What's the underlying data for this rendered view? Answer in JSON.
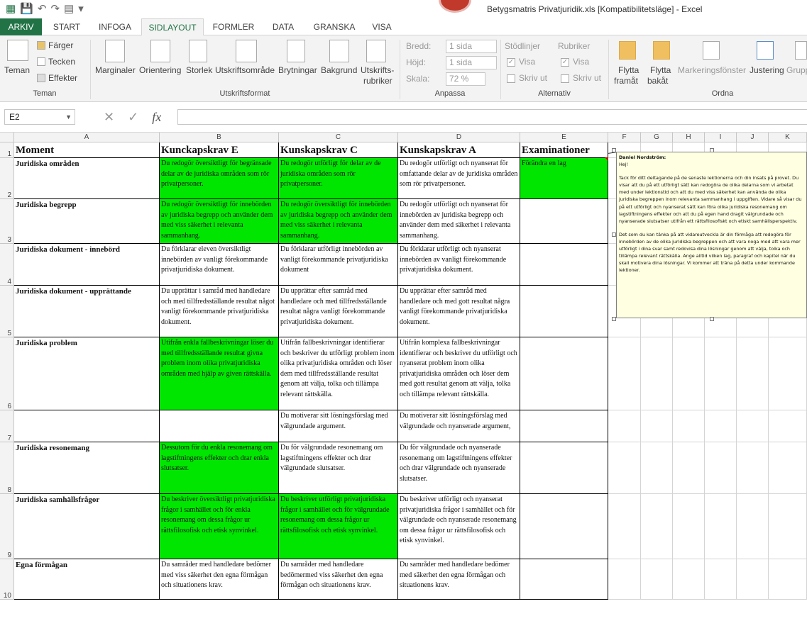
{
  "window": {
    "title": "Betygsmatris Privatjuridik.xls  [Kompatibilitetsläge] - Excel"
  },
  "ribbon_tabs": [
    "ARKIV",
    "START",
    "INFOGA",
    "SIDLAYOUT",
    "FORMLER",
    "DATA",
    "GRANSKA",
    "VISA"
  ],
  "ribbon": {
    "teman": {
      "themes": "Teman",
      "colors": "Färger",
      "fonts": "Tecken",
      "effects": "Effekter",
      "group": "Teman"
    },
    "page_setup": {
      "margins": "Marginaler",
      "orientation": "Orientering",
      "size": "Storlek",
      "print_area": "Utskriftsområde",
      "breaks": "Brytningar",
      "background": "Bakgrund",
      "print_titles_1": "Utskrifts-",
      "print_titles_2": "rubriker",
      "group": "Utskriftsformat"
    },
    "scale": {
      "width_label": "Bredd:",
      "width_value": "1 sida",
      "height_label": "Höjd:",
      "height_value": "1 sida",
      "scale_label": "Skala:",
      "scale_value": "72 %",
      "group": "Anpassa"
    },
    "sheet_options": {
      "gridlines": "Stödlinjer",
      "headings": "Rubriker",
      "view": "Visa",
      "print": "Skriv ut",
      "group": "Alternativ"
    },
    "arrange": {
      "forward_1": "Flytta",
      "forward_2": "framåt",
      "backward_1": "Flytta",
      "backward_2": "bakåt",
      "selection_pane": "Markeringsfönster",
      "align": "Justering",
      "group_btn": "Grupp",
      "group": "Ordna"
    }
  },
  "formula_bar": {
    "name_box": "E2",
    "fx": "fx"
  },
  "columns": [
    "A",
    "B",
    "C",
    "D",
    "E",
    "F",
    "G",
    "H",
    "I",
    "J",
    "K"
  ],
  "rows": [
    "1",
    "2",
    "3",
    "4",
    "5",
    "6",
    "7",
    "8",
    "9",
    "10"
  ],
  "sheet": {
    "headers": [
      "Moment",
      "Kunckapskrav E",
      "Kunskapskrav C",
      "Kunskapskrav A",
      "Examinationer"
    ],
    "row_labels": [
      "Juridiska områden",
      "Juridiska begrepp",
      "Juridiska dokument - innebörd",
      "Juridiska dokument - upprättande",
      "Juridiska problem",
      "",
      "Juridiska resonemang",
      "Juridiska samhällsfrågor",
      "Egna förmågan"
    ],
    "b": [
      "Du redogör översiktligt för begränsade delar av de juridiska områden som rör privatpersoner.",
      "Du redogör översiktligt för innebörden av juridiska begrepp och använder dem med viss säkerhet i relevanta sammanhang.",
      "Du förklarar eleven översiktligt innebörden av vanligt förekommande privatjuridiska dokument.",
      "Du upprättar i samråd med handledare och med tillfredsställande resultat något vanligt förekommande privatjuridiska dokument.",
      "Utifrån enkla fallbeskrivningar löser du med tillfredsställande resultat givna problem inom olika privatjuridiska områden med hjälp av given rättskälla.",
      "",
      "Dessutom för du enkla resonemang om lagstiftningens effekter och drar enkla slutsatser.",
      "Du beskriver översiktligt privatjuridiska frågor i samhället och för enkla resonemang om dessa frågor ur rättsfilosofisk och etisk synvinkel.",
      "Du samråder med handledare bedömer med viss säkerhet den egna förmågan och situationens krav."
    ],
    "c": [
      "Du redogör utförligt för delar av de juridiska områden som rör privatpersoner.",
      "Du redogör översiktligt för innebörden av juridiska begrepp och använder dem med viss säkerhet i relevanta sammanhang.",
      "Du förklarar utförligt innebörden av vanligt förekommande privatjuridiska dokument",
      "Du upprättar efter samråd med handledare och med tillfredsställande resultat några vanligt förekommande privatjuridiska dokument.",
      "Utifrån fallbeskrivningar identifierar och beskriver du utförligt problem inom olika privatjuridiska områden och löser dem med tillfredsställande resultat genom att välja, tolka och tillämpa relevant rättskälla.",
      "Du  motiverar sitt lösningsförslag med välgrundade argument.",
      "Du för välgrundade resonemang om lagstiftningens effekter och drar välgrundade slutsatser.",
      "Du beskriver utförligt privatjuridiska frågor i samhället och för välgrundade resonemang om dessa frågor ur rättsfilosofisk och etisk synvinkel.",
      "Du samråder med handledare bedömermed viss säkerhet den egna förmågan och situationens krav."
    ],
    "d": [
      "Du redogör utförligt och nyanserat för omfattande delar av de juridiska områden som rör privatpersoner.",
      "Du redogör utförligt och nyanserat för innebörden av juridiska begrepp och använder dem med säkerhet i relevanta sammanhang.",
      "Du förklarar utförligt och nyanserat innebörden av vanligt förekommande privatjuridiska dokument.",
      "Du upprättar efter samråd med handledare och med gott resultat några vanligt förekommande privatjuridiska dokument.",
      "Utifrån komplexa fallbeskrivningar identifierar och beskriver du utförligt och nyanserat problem inom olika privatjuridiska områden och löser dem med gott resultat genom att välja, tolka och tillämpa relevant rättskälla.",
      "Du  motiverar sitt lösningsförslag med välgrundade och nyanserade argument,",
      "Du för välgrundade och nyanserade resonemang om lagstiftningens effekter och drar välgrundade och nyanserade slutsatser.",
      "Du beskriver utförligt och nyanserat privatjuridiska frågor i samhället och för välgrundade och nyanserade resonemang om dessa frågor ur rättsfilosofisk och etisk synvinkel.",
      "Du samråder med handledare bedömer  med säkerhet den egna förmågan och situationens krav."
    ],
    "e": [
      "Förändra en lag",
      "",
      "",
      "",
      "",
      "",
      "",
      "",
      ""
    ]
  },
  "comment": {
    "author": "Daniel Nordström:",
    "greeting": "Hej!",
    "p1": "Tack för ditt deltagande på de senaste lektionerna och din insats på provet. Du visar att du på ett utförligt sätt kan redogöra de olika delarna som vi arbetat med under lektionstid och att du med viss säkerhet kan använda de olika juridiska begreppen inom relevanta sammanhang i uppgiften. Vidare så visar du på ett utförligt och nyanserat sätt kan föra olika juridiska resonemang om lagstiftningens effekter och att du på egen hand dragit välgrundade och nyanserade slutsatser utifrån ett rättsfilosofiskt och etiskt samhällsperspektiv.",
    "p2": "Det som du kan tänka på att vidareutveckla är din förmåga att redogöra för innebörden av de olika juridiska begreppen och att vara noga med att vara mer utförligt i dina svar samt redovisa dina lösningar genom att välja, tolka och tillämpa relevant rättskälla.  Ange alltid vilken lag, paragraf och kapitel när du skall motivera dina lösningar. Vi kommer att träna på detta under kommande lektioner."
  }
}
